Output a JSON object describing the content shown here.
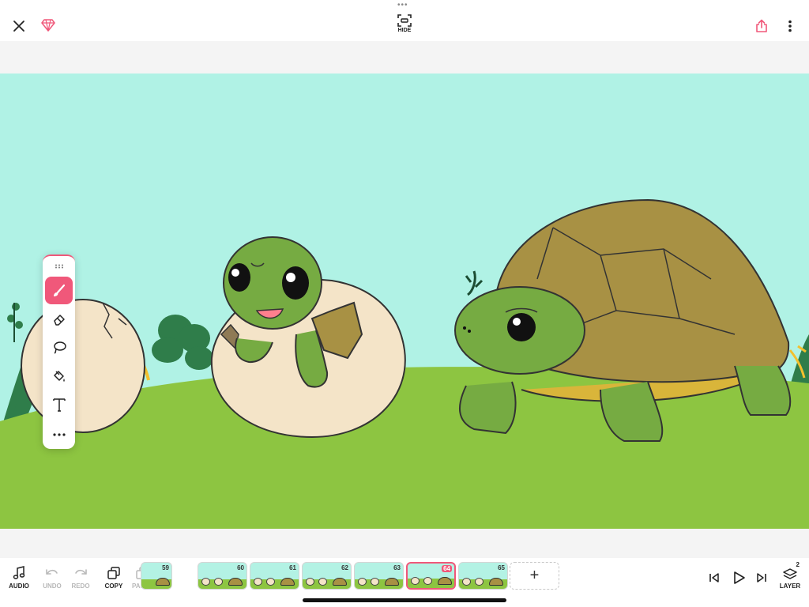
{
  "top": {
    "hide_label": "HIDE"
  },
  "toolbar": {
    "tools": [
      "drag-handle",
      "brush",
      "eraser",
      "lasso",
      "fill-bucket",
      "text",
      "more"
    ],
    "active_tool": "brush"
  },
  "bottom": {
    "audio_label": "AUDIO",
    "undo_label": "UNDO",
    "redo_label": "REDO",
    "copy_label": "COPY",
    "paste_label": "PASTE",
    "layer_label": "LAYER",
    "layer_count": "2",
    "add_label": "+"
  },
  "frames": [
    {
      "num": "59"
    },
    {
      "num": "60"
    },
    {
      "num": "61"
    },
    {
      "num": "62"
    },
    {
      "num": "63"
    },
    {
      "num": "64"
    },
    {
      "num": "65"
    }
  ],
  "current_frame": "64",
  "colors": {
    "accent": "#f0587a",
    "sky": "#b0f2e5",
    "grass": "#8dc541",
    "shell": "#a89144",
    "turtle_skin": "#76ab42",
    "egg": "#f4e4c8"
  }
}
